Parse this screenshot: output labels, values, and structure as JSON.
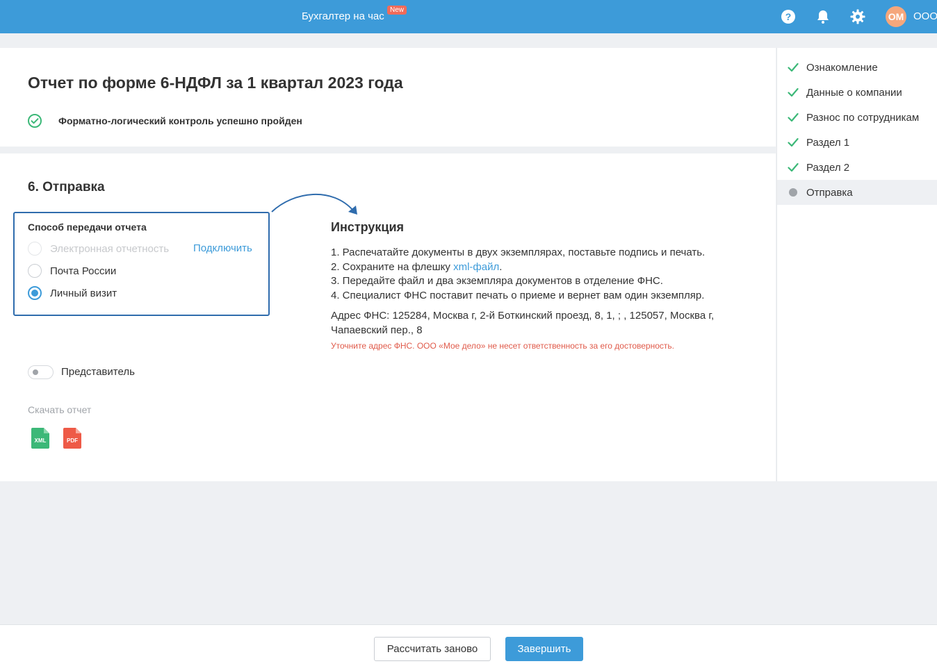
{
  "header": {
    "promo_label": "Бухгалтер на час",
    "new_badge": "New",
    "avatar_initials": "ОМ",
    "org_name": "ООО",
    "icons": [
      "help-icon",
      "bell-icon",
      "gear-icon"
    ]
  },
  "report": {
    "title": "Отчет по форме 6-НДФЛ за 1 квартал 2023 года",
    "status": "Форматно-логический контроль успешно пройден"
  },
  "section": {
    "title": "6. Отправка"
  },
  "transfer": {
    "label": "Способ передачи отчета",
    "options": [
      {
        "label": "Электронная отчетность",
        "disabled": true,
        "checked": false
      },
      {
        "label": "Почта России",
        "disabled": false,
        "checked": false
      },
      {
        "label": "Личный визит",
        "disabled": false,
        "checked": true
      }
    ],
    "connect_link": "Подключить"
  },
  "instruction": {
    "title": "Инструкция",
    "steps": [
      "1. Распечатайте документы в двух экземплярах, поставьте подпись и печать.",
      "2. Сохраните на флешку ",
      "3. Передайте файл и два экземпляра документов в отделение ФНС.",
      "4. Специалист ФНС поставит печать о приеме и вернет вам один экземпляр."
    ],
    "xml_link": "xml-файл",
    "step2_tail": ".",
    "address": "Адрес ФНС: 125284, Москва г, 2-й Боткинский проезд, 8, 1, ; , 125057, Москва г, Чапаевский пер., 8",
    "warning": "Уточните адрес ФНС. ООО «Мое дело» не несет ответственность за его достоверность."
  },
  "representative": {
    "label": "Представитель",
    "enabled": false
  },
  "download": {
    "label": "Скачать отчет",
    "xml_label": "XML",
    "pdf_label": "PDF"
  },
  "steps_sidebar": [
    {
      "label": "Ознакомление",
      "done": true
    },
    {
      "label": "Данные о компании",
      "done": true
    },
    {
      "label": "Разнос по сотрудникам",
      "done": true
    },
    {
      "label": "Раздел 1",
      "done": true
    },
    {
      "label": "Раздел 2",
      "done": true
    },
    {
      "label": "Отправка",
      "done": false,
      "active": true
    }
  ],
  "footer": {
    "recalc_label": "Рассчитать заново",
    "finish_label": "Завершить"
  },
  "colors": {
    "header": "#3d9bd9",
    "accent": "#3d9bd9",
    "success": "#3cb878",
    "warning": "#e05a4a",
    "avatar": "#f5a77c"
  }
}
